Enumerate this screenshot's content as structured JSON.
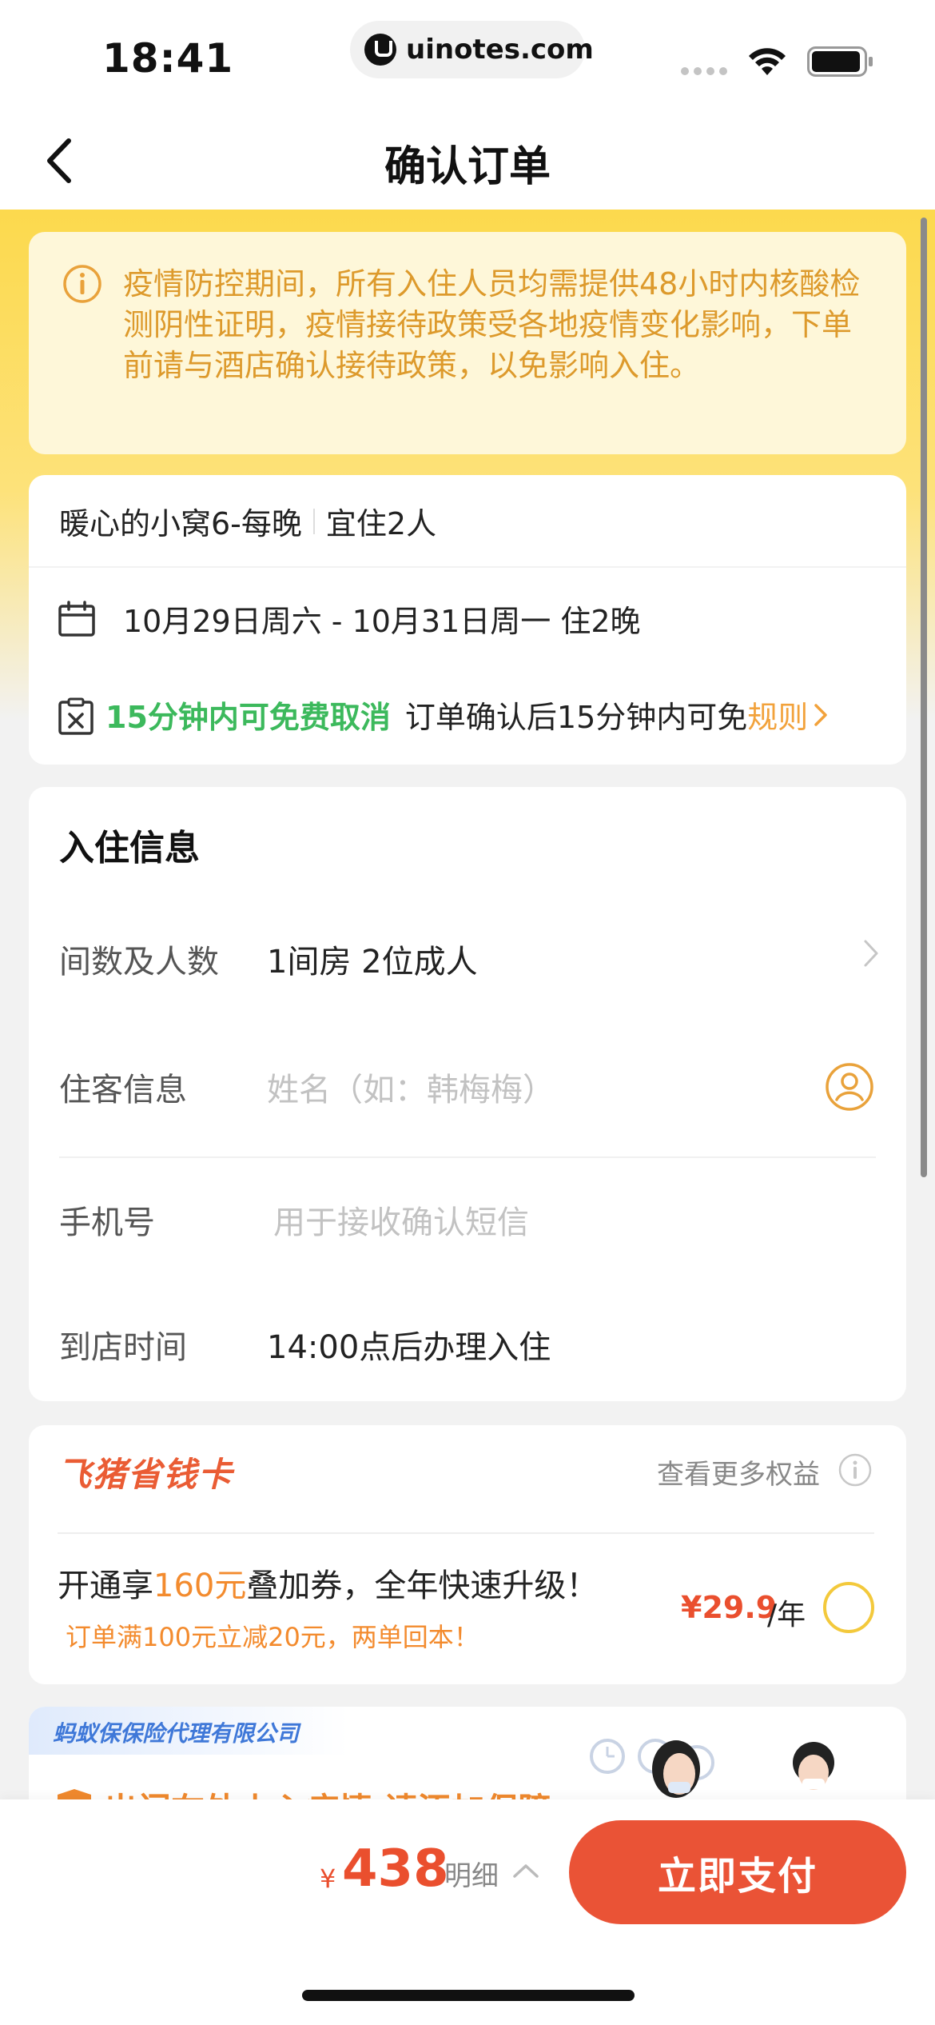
{
  "status_bar": {
    "time": "18:41",
    "url": "uinotes.com"
  },
  "nav": {
    "title": "确认订单",
    "back_icon": "chevron-left-icon"
  },
  "notice": {
    "icon": "info-circle-icon",
    "text": "疫情防控期间，所有入住人员均需提供48小时内核酸检测阴性证明，疫情接待政策受各地疫情变化影响，下单前请与酒店确认接待政策，以免影响入住。"
  },
  "room": {
    "name": "暖心的小窝6-每晚",
    "capacity": "宜住2人",
    "dates": "10月29日周六 - 10月31日周一 住2晚",
    "cancel_free": "15分钟内可免费取消",
    "cancel_desc": "订单确认后15分钟内可免",
    "rules_link": "规则"
  },
  "checkin": {
    "title": "入住信息",
    "rooms_label": "间数及人数",
    "rooms_value": "1间房 2位成人",
    "guest_label": "住客信息",
    "guest_placeholder": "姓名（如：韩梅梅）",
    "phone_label": "手机号",
    "phone_placeholder": "用于接收确认短信",
    "arrival_label": "到店时间",
    "arrival_value": "14:00点后办理入住"
  },
  "savings_card": {
    "brand": "飞猪省钱卡",
    "more_link": "查看更多权益",
    "main_prefix": "开通享",
    "main_highlight": "160元",
    "main_suffix": "叠加券，全年快速升级！",
    "sub": "订单满100元立减20元，两单回本！",
    "price": "¥29.9",
    "price_unit": "/年"
  },
  "insurance": {
    "tag": "蚂蚁保保险代理有限公司",
    "title": "出门在外小心疫情 请添加保障"
  },
  "bottom_bar": {
    "currency": "¥",
    "total": "438",
    "detail_label": "明细",
    "pay_button": "立即支付"
  },
  "colors": {
    "accent_yellow": "#fcd94d",
    "notice_text": "#dd9a2c",
    "free_cancel_green": "#3cb95c",
    "price_red": "#ea4f2e",
    "pay_button": "#ea5336"
  }
}
